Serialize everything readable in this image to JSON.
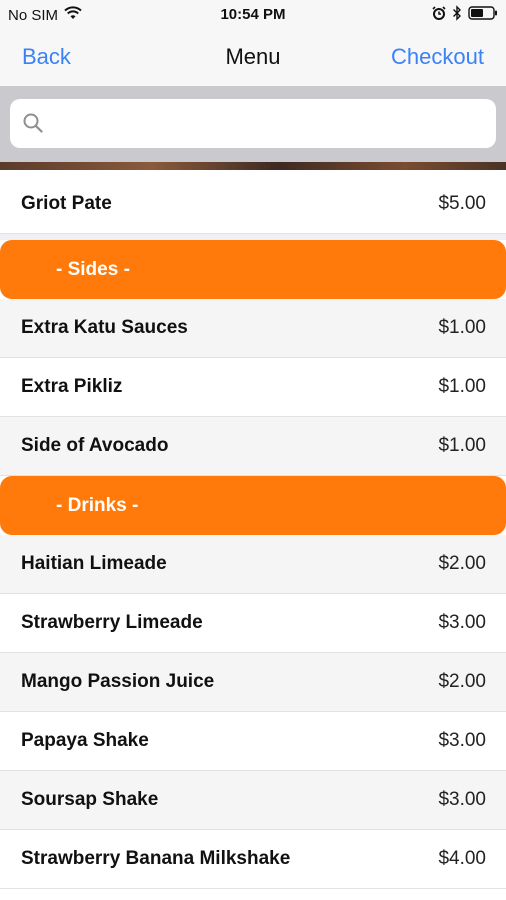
{
  "status_bar": {
    "carrier": "No SIM",
    "time": "10:54 PM",
    "icons": [
      "wifi-icon",
      "alarm-icon",
      "bluetooth-icon",
      "battery-icon"
    ]
  },
  "nav": {
    "back_label": "Back",
    "title": "Menu",
    "checkout_label": "Checkout"
  },
  "search": {
    "placeholder": "",
    "value": ""
  },
  "colors": {
    "accent_blue": "#3b82f6",
    "section_orange": "#ff7a0a"
  },
  "menu": {
    "top_item": {
      "name": "Griot Pate",
      "price": "$5.00"
    },
    "sides": {
      "header": "- Sides -",
      "items": [
        {
          "name": "Extra Katu Sauces",
          "price": "$1.00"
        },
        {
          "name": "Extra Pikliz",
          "price": "$1.00"
        },
        {
          "name": "Side of Avocado",
          "price": "$1.00"
        }
      ]
    },
    "drinks": {
      "header": "- Drinks -",
      "items": [
        {
          "name": "Haitian Limeade",
          "price": "$2.00"
        },
        {
          "name": "Strawberry Limeade",
          "price": "$3.00"
        },
        {
          "name": "Mango Passion Juice",
          "price": "$2.00"
        },
        {
          "name": "Papaya Shake",
          "price": "$3.00"
        },
        {
          "name": "Soursap Shake",
          "price": "$3.00"
        },
        {
          "name": "Strawberry Banana Milkshake",
          "price": "$4.00"
        }
      ]
    }
  }
}
